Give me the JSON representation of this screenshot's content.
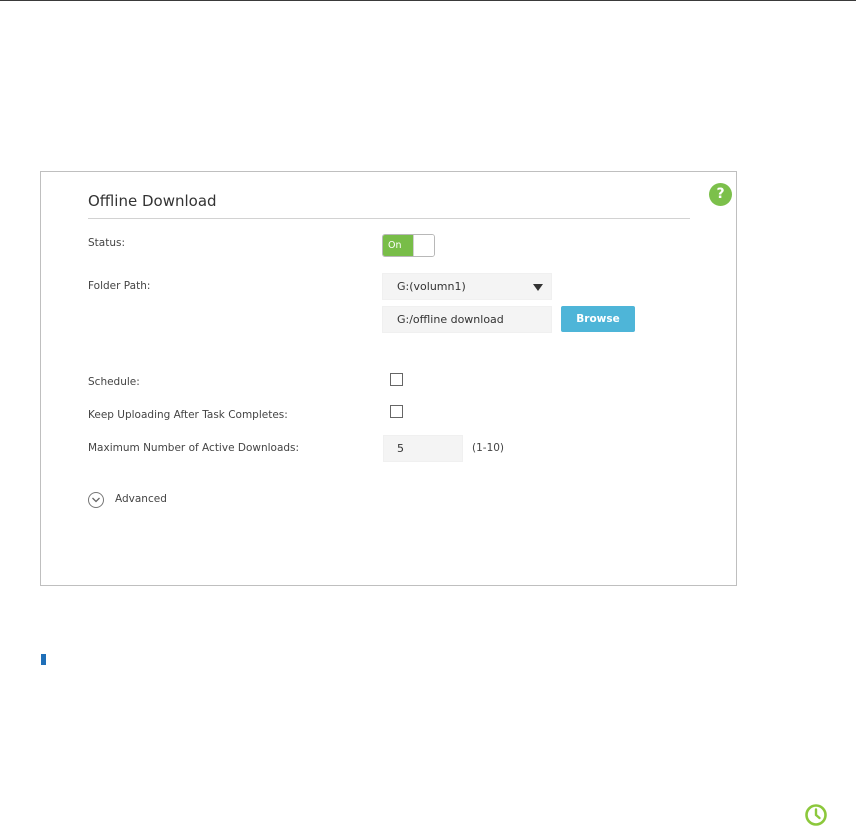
{
  "panel": {
    "title": "Offline Download",
    "help_icon_glyph": "?",
    "colors": {
      "accent_green": "#78bd48",
      "browse_blue": "#4eb5d8",
      "note_marker_blue": "#1f6fb8"
    }
  },
  "form": {
    "status": {
      "label": "Status:",
      "toggle_text": "On",
      "state": "on"
    },
    "folder_path": {
      "label": "Folder Path:",
      "volume_selected": "G:(volumn1)",
      "path_value": "G:/offline download",
      "browse_label": "Browse"
    },
    "schedule": {
      "label": "Schedule:",
      "checked": false
    },
    "keep_uploading": {
      "label": "Keep Uploading After Task Completes:",
      "checked": false
    },
    "max_downloads": {
      "label": "Maximum Number of Active Downloads:",
      "value": "5",
      "range_hint": "(1-10)"
    },
    "advanced": {
      "label": "Advanced",
      "icon": "chevron-down-circle-icon"
    }
  },
  "icons": {
    "help": "question-circle-icon",
    "footer": "clock-icon"
  }
}
